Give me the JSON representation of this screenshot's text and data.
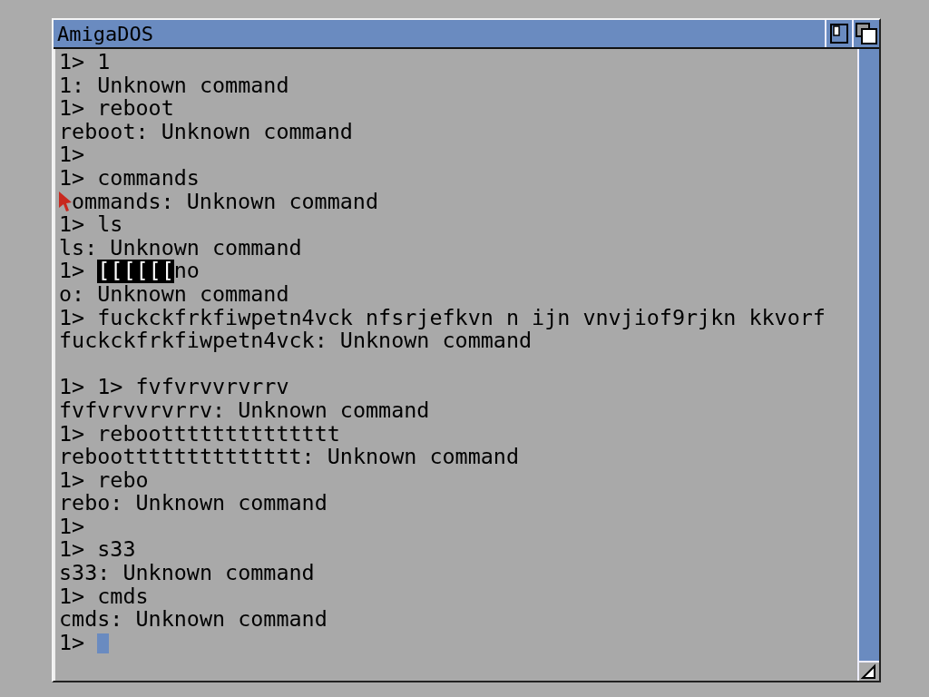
{
  "window": {
    "title": "AmigaDOS"
  },
  "lines": [
    {
      "kind": "text",
      "text": "1> 1"
    },
    {
      "kind": "text",
      "text": "1: Unknown command"
    },
    {
      "kind": "text",
      "text": "1> reboot"
    },
    {
      "kind": "text",
      "text": "reboot: Unknown command"
    },
    {
      "kind": "text",
      "text": "1>"
    },
    {
      "kind": "text",
      "text": "1> commands"
    },
    {
      "kind": "pointer",
      "text": "ommands: Unknown command"
    },
    {
      "kind": "text",
      "text": "1> ls"
    },
    {
      "kind": "text",
      "text": "ls: Unknown command"
    },
    {
      "kind": "highlight",
      "prompt": "1>",
      "highlight": "[[[[[[",
      "text": "no"
    },
    {
      "kind": "text",
      "text": "o: Unknown command"
    },
    {
      "kind": "text",
      "text": "1> fuckckfrkfiwpetn4vck nfsrjefkvn n ijn vnvjiof9rjkn kkvorf"
    },
    {
      "kind": "text",
      "text": "fuckckfrkfiwpetn4vck: Unknown command"
    },
    {
      "kind": "blank"
    },
    {
      "kind": "text",
      "text": "1> 1> fvfvrvvrvrrv"
    },
    {
      "kind": "text",
      "text": "fvfvrvvrvrrv: Unknown command"
    },
    {
      "kind": "text",
      "text": "1> rebootttttttttttttt"
    },
    {
      "kind": "text",
      "text": "rebootttttttttttttt: Unknown command"
    },
    {
      "kind": "text",
      "text": "1> rebo"
    },
    {
      "kind": "text",
      "text": "rebo: Unknown command"
    },
    {
      "kind": "text",
      "text": "1>"
    },
    {
      "kind": "text",
      "text": "1> s33"
    },
    {
      "kind": "text",
      "text": "s33: Unknown command"
    },
    {
      "kind": "text",
      "text": "1> cmds"
    },
    {
      "kind": "text",
      "text": "cmds: Unknown command"
    },
    {
      "kind": "cursor",
      "text": "1>"
    }
  ]
}
